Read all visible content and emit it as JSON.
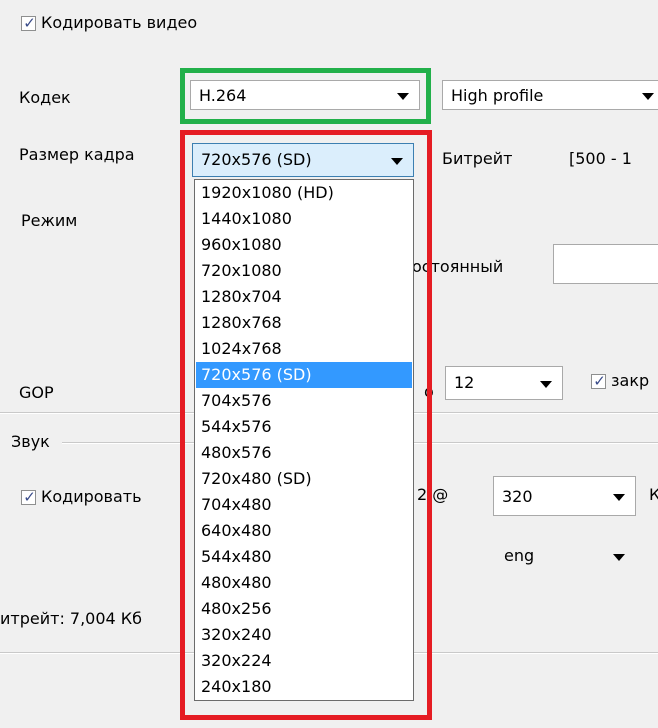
{
  "video": {
    "encode_checkbox_label": "Кодировать видео",
    "encode_checked": true,
    "codec_label": "Кодек",
    "codec_value": "H.264",
    "profile_value": "High profile",
    "frame_size_label": "Размер кадра",
    "frame_size_value": "720x576 (SD)",
    "bitrate_label": "Битрейт",
    "bitrate_range": "[500 - 1",
    "mode_label": "Режим",
    "mode_partial_label": "остоянный",
    "gop_label": "GOP",
    "gop_partial_label": "о",
    "gop_value": "12",
    "closed_label_partial": "закр",
    "closed_checked": true
  },
  "frame_size_options": [
    "1920x1080 (HD)",
    "1440x1080",
    "960x1080",
    "720x1080",
    "1280x704",
    "1280x768",
    "1024x768",
    "720x576 (SD)",
    "704x576",
    "544x576",
    "480x576",
    "720x480 (SD)",
    "704x480",
    "640x480",
    "544x480",
    "480x480",
    "480x256",
    "320x240",
    "320x224",
    "240x180"
  ],
  "frame_size_selected_index": 7,
  "audio": {
    "group_label": "Звук",
    "encode_checkbox_label": "Кодировать",
    "encode_checked": true,
    "partial_at_label": "2 @",
    "bitrate_value": "320",
    "right_partial_label": "К",
    "language_value": "eng"
  },
  "footer": {
    "bitrate_text": "итрейт: 7,004 Кб"
  },
  "colors": {
    "highlight_green": "#22b04a",
    "highlight_red": "#e51c23",
    "selection_blue": "#3399ff"
  }
}
